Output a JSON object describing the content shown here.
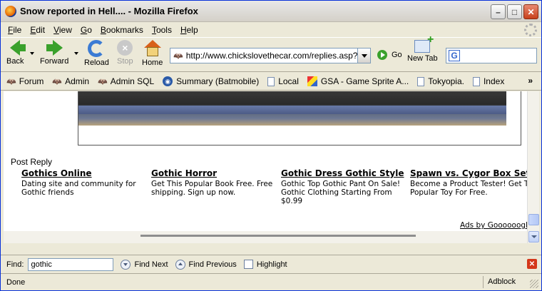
{
  "window": {
    "title": "Snow reported in Hell.... - Mozilla Firefox"
  },
  "menu": [
    {
      "key": "F",
      "rest": "ile"
    },
    {
      "key": "E",
      "rest": "dit"
    },
    {
      "key": "V",
      "rest": "iew"
    },
    {
      "key": "G",
      "rest": "o"
    },
    {
      "key": "B",
      "rest": "ookmarks"
    },
    {
      "key": "T",
      "rest": "ools"
    },
    {
      "key": "H",
      "rest": "elp"
    }
  ],
  "toolbar": {
    "back": "Back",
    "forward": "Forward",
    "reload": "Reload",
    "stop": "Stop",
    "home": "Home",
    "go": "Go",
    "new_tab": "New Tab",
    "url": "http://www.chickslovethecar.com/replies.asp?pa",
    "search_value": ""
  },
  "bookmarks": {
    "forum": "Forum",
    "admin": "Admin",
    "admin_sql": "Admin SQL",
    "summary": "Summary (Batmobile)",
    "local": "Local",
    "gsa": "GSA - Game Sprite A...",
    "tokyopia": "Tokyopia.",
    "index": "Index"
  },
  "content": {
    "post_reply": "Post Reply",
    "ads": [
      {
        "title": "Gothics Online",
        "text": "Dating site and community for Gothic friends"
      },
      {
        "title": "Gothic Horror",
        "text": "Get This Popular Book Free. Free shipping. Sign up now."
      },
      {
        "title": "Gothic Dress Gothic Style",
        "text": "Gothic Top Gothic Pant On Sale! Gothic Clothing Starting From $0.99"
      },
      {
        "title": "Spawn vs. Cygor Box Set",
        "text": "Become a Product Tester! Get This Popular Toy For Free."
      }
    ],
    "ads_by": "Ads by Goooooogle"
  },
  "findbar": {
    "label": "Find:",
    "value": "gothic",
    "next": "Find Next",
    "previous": "Find Previous",
    "highlight": "Highlight"
  },
  "status": {
    "text": "Done",
    "adblock": "Adblock"
  }
}
